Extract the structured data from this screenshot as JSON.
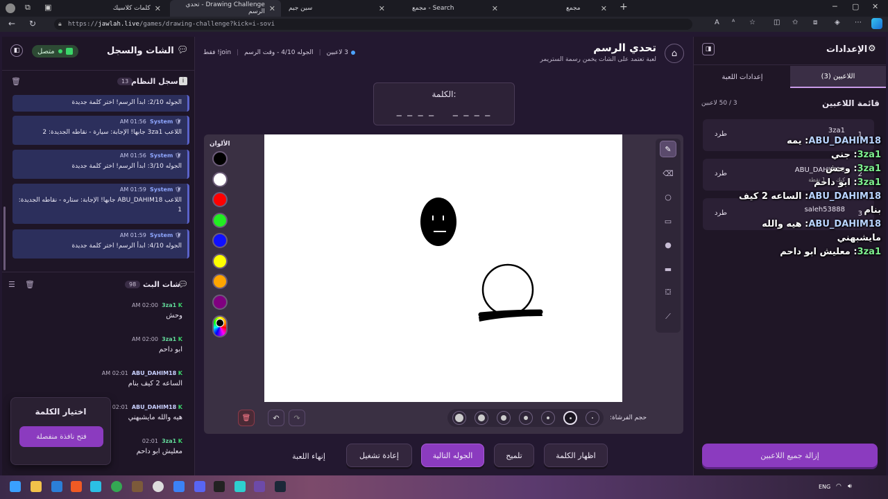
{
  "browser": {
    "tabs": [
      {
        "title": "كلمات كلاسيك"
      },
      {
        "title": "Drawing Challenge - تحدي الرسم"
      },
      {
        "title": "سين جيم"
      },
      {
        "title": "Search - مجمع"
      },
      {
        "title": "مجمع"
      }
    ],
    "url_prefix": "https://",
    "url_host": "jawlah.live",
    "url_path": "/games/drawing-challenge?kick=i-sovi"
  },
  "left": {
    "title": "الشات والسجل",
    "status": "متصل",
    "syslog": {
      "title": "سجل النظام",
      "count": "13",
      "items": [
        {
          "time": "",
          "source": "",
          "msg": "الجوله 2/10: ابدأ الرسم! اختر كلمة جديدة"
        },
        {
          "time": "AM 01:56",
          "source": "System",
          "msg": "اللاعب 3za1 جابها! الإجابة: سيارة - نقاطه الجديدة: 2"
        },
        {
          "time": "AM 01:56",
          "source": "System",
          "msg": "الجوله 3/10: ابدأ الرسم! اختر كلمة جديدة"
        },
        {
          "time": "AM 01:59",
          "source": "System",
          "msg": "اللاعب ABU_DAHIM18 جابها! الإجابة: ستاره - نقاطه الجديدة: 1"
        },
        {
          "time": "AM 01:59",
          "source": "System",
          "msg": "الجوله 4/10: ابدأ الرسم! اختر كلمة جديدة"
        }
      ]
    },
    "chat": {
      "title": "شات البث",
      "count": "98",
      "items": [
        {
          "user": "3za1",
          "time": "AM 02:00",
          "msg": "وحش"
        },
        {
          "user": "3za1",
          "time": "AM 02:00",
          "msg": "ابو داحم"
        },
        {
          "user": "ABU_DAHIM18",
          "time": "AM 02:01",
          "msg": "الساعه 2 كيف بنام"
        },
        {
          "user": "ABU_DAHIM18",
          "time": "02:01",
          "msg": "هيه والله مايشبهني"
        },
        {
          "user": "3za1",
          "time": "02:01",
          "msg": "معليش ابو داحم"
        }
      ]
    },
    "word_popup": {
      "title": "اختيار الكلمة",
      "button": "فتح نافذة منفصلة"
    }
  },
  "center": {
    "title": "تحدي الرسم",
    "subtitle": "لعبة تعتمد على الشات يخمن رسمة الستريمر",
    "meta_players": "3 لاعبين",
    "meta_round": "الجوله 4/10 - وقت الرسم",
    "meta_join": "join! فقط",
    "word_label": "الكلمة:",
    "word_mask": "_ _ _ _    _ _ _ _",
    "colors_label": "الألوان",
    "colors": [
      "#000000",
      "#ffffff",
      "#ff0000",
      "#22ee22",
      "#1010ff",
      "#ffff00",
      "#ffa500",
      "#800080"
    ],
    "brush_label": "حجم الفرشاة:",
    "buttons": {
      "end": "إنهاء اللعبة",
      "restart": "إعادة تشغيل",
      "next": "الجوله التالية",
      "hint": "تلميح",
      "reveal": "اظهار الكلمة"
    }
  },
  "right": {
    "title": "الإعدادات",
    "tab_players": "اللاعبين (3)",
    "tab_settings": "إعدادات اللعبة",
    "list_title": "قائمة اللاعبين",
    "list_count": "3 / 50 لاعبين",
    "kick_label": "طرد",
    "players": [
      {
        "rank": "1",
        "name": "3za1",
        "platform": "كيك",
        "points": ""
      },
      {
        "rank": "2",
        "name": "ABU_DAHIM18",
        "platform": "كيك",
        "points": "1 نقطة"
      },
      {
        "rank": "3",
        "name": "saleh53888",
        "platform": "",
        "points": ""
      }
    ],
    "remove_all": "إزالة جميع اللاعبين"
  },
  "overlay_chat": [
    {
      "user": "ABU_DAHIM18",
      "msg": "يمه"
    },
    {
      "user": "3za1",
      "msg": "جني"
    },
    {
      "user": "3za1",
      "msg": "وحش"
    },
    {
      "user": "3za1",
      "msg": "ابو داحم"
    },
    {
      "user": "ABU_DAHIM18",
      "msg": "الساعه 2 كيف بنام"
    },
    {
      "user": "ABU_DAHIM18",
      "msg": "هيه والله مايشبهني"
    },
    {
      "user": "3za1",
      "msg": "معليش ابو داحم"
    }
  ],
  "taskbar": {
    "lang": "ENG"
  }
}
